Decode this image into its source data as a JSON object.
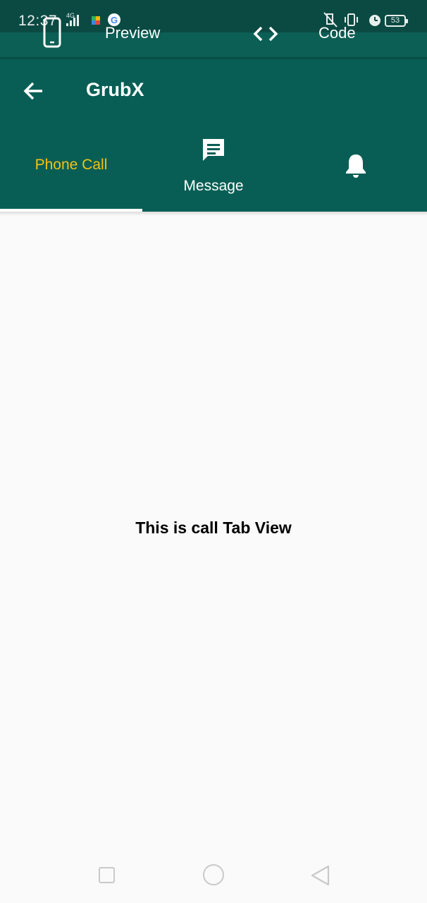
{
  "status_bar": {
    "time": "12:37",
    "network_label": "4G",
    "battery_level": "53",
    "icons": [
      "signal-bars-icon",
      "play-store-icon",
      "google-icon",
      "mute-icon",
      "vibrate-icon",
      "alarm-icon",
      "battery-icon"
    ]
  },
  "preview_bar": {
    "preview_label": "Preview",
    "code_label": "Code",
    "icons": [
      "phone-device-icon",
      "code-brackets-icon"
    ]
  },
  "app_bar": {
    "title": "GrubX",
    "back_icon": "arrow-back-icon"
  },
  "tabs": [
    {
      "label": "Phone Call",
      "icon": null,
      "selected": true
    },
    {
      "label": "Message",
      "icon": "message-icon",
      "selected": false
    },
    {
      "label": "",
      "icon": "bell-icon",
      "selected": false
    }
  ],
  "body": {
    "text": "This is call Tab View"
  },
  "navigation_bar": {
    "buttons": [
      "recents-button",
      "home-button",
      "back-button"
    ]
  },
  "colors": {
    "app_bar": "#085e55",
    "status_bar": "#0b4a43",
    "selected_tab_label": "#f2c311",
    "tab_indicator": "#ffffff",
    "background": "#fafafa"
  }
}
